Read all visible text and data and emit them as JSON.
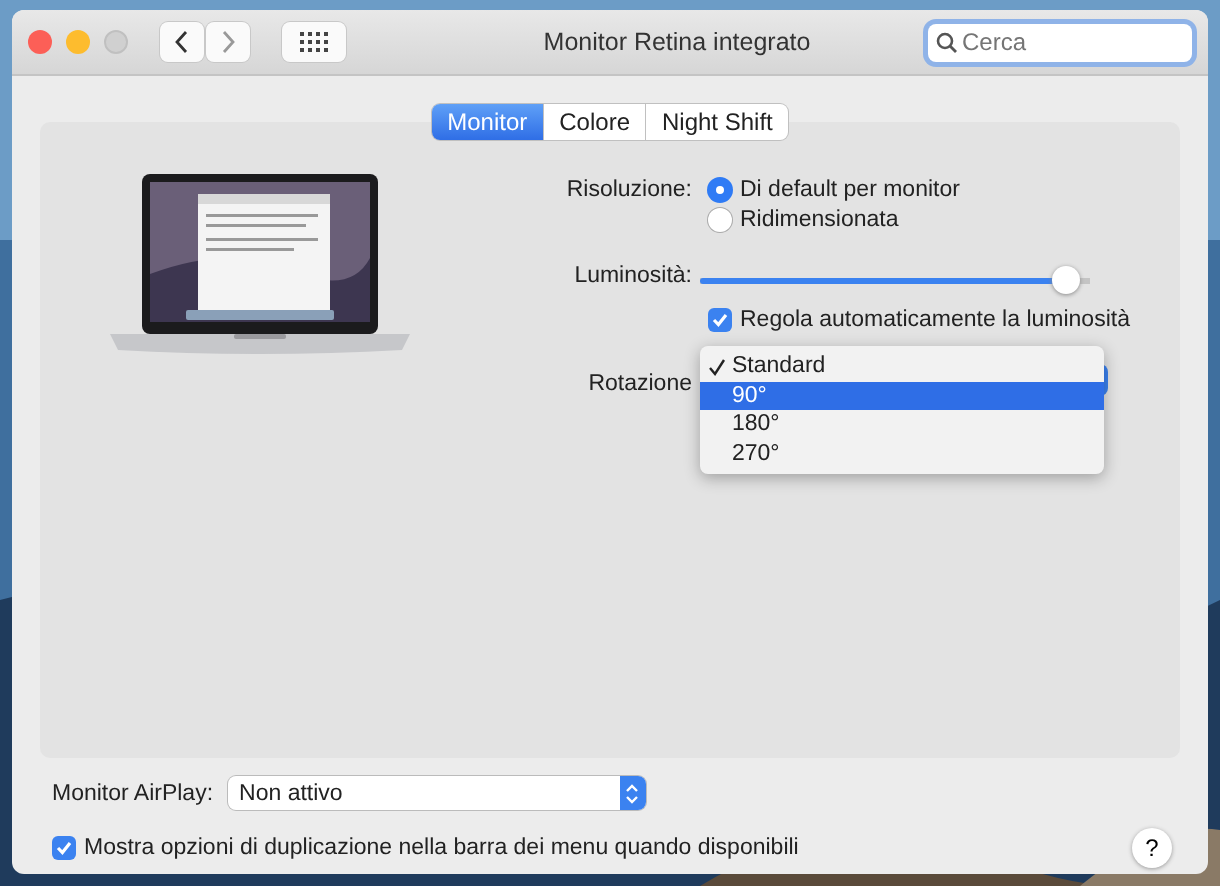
{
  "window": {
    "title": "Monitor Retina integrato"
  },
  "search": {
    "placeholder": "Cerca"
  },
  "tabs": [
    {
      "label": "Monitor",
      "selected": true
    },
    {
      "label": "Colore",
      "selected": false
    },
    {
      "label": "Night Shift",
      "selected": false
    }
  ],
  "resolution": {
    "label": "Risoluzione:",
    "options": [
      {
        "label": "Di default per monitor",
        "selected": true
      },
      {
        "label": "Ridimensionata",
        "selected": false
      }
    ]
  },
  "brightness": {
    "label": "Luminosità:",
    "level": 0.94
  },
  "auto_brightness": {
    "label": "Regola automaticamente la luminosità",
    "checked": true
  },
  "rotation": {
    "label": "Rotazione",
    "menu": [
      {
        "label": "Standard",
        "checked": true,
        "selected": false
      },
      {
        "label": "90°",
        "checked": false,
        "selected": true
      },
      {
        "label": "180°",
        "checked": false,
        "selected": false
      },
      {
        "label": "270°",
        "checked": false,
        "selected": false
      }
    ]
  },
  "airplay": {
    "label": "Monitor AirPlay:",
    "value": "Non attivo"
  },
  "mirroring": {
    "label": "Mostra opzioni di duplicazione nella barra dei menu quando disponibili",
    "checked": true
  },
  "help": "?"
}
